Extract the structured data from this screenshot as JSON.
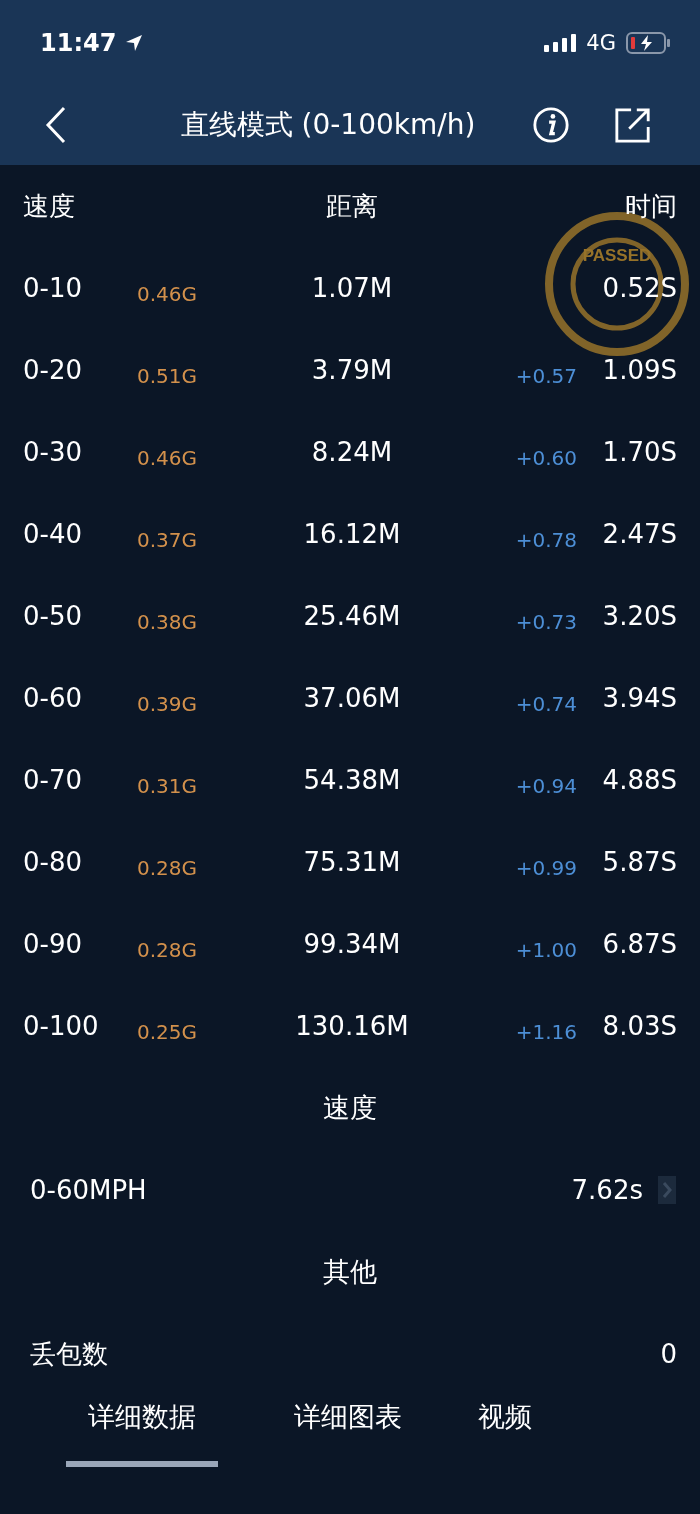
{
  "status_bar": {
    "time": "11:47",
    "network": "4G"
  },
  "nav": {
    "title": "直线模式 (0-100km/h)"
  },
  "table": {
    "columns": [
      "速度",
      "距离",
      "时间"
    ],
    "rows": [
      {
        "speed": "0-10",
        "g": "0.46G",
        "distance": "1.07M",
        "time": "0.52S"
      },
      {
        "speed": "0-20",
        "g": "0.51G",
        "distance": "3.79M",
        "delta": "+0.57",
        "time": "1.09S"
      },
      {
        "speed": "0-30",
        "g": "0.46G",
        "distance": "8.24M",
        "delta": "+0.60",
        "time": "1.70S"
      },
      {
        "speed": "0-40",
        "g": "0.37G",
        "distance": "16.12M",
        "delta": "+0.78",
        "time": "2.47S"
      },
      {
        "speed": "0-50",
        "g": "0.38G",
        "distance": "25.46M",
        "delta": "+0.73",
        "time": "3.20S"
      },
      {
        "speed": "0-60",
        "g": "0.39G",
        "distance": "37.06M",
        "delta": "+0.74",
        "time": "3.94S"
      },
      {
        "speed": "0-70",
        "g": "0.31G",
        "distance": "54.38M",
        "delta": "+0.94",
        "time": "4.88S"
      },
      {
        "speed": "0-80",
        "g": "0.28G",
        "distance": "75.31M",
        "delta": "+0.99",
        "time": "5.87S"
      },
      {
        "speed": "0-90",
        "g": "0.28G",
        "distance": "99.34M",
        "delta": "+1.00",
        "time": "6.87S"
      },
      {
        "speed": "0-100",
        "g": "0.25G",
        "distance": "130.16M",
        "delta": "+1.16",
        "time": "8.03S"
      }
    ]
  },
  "stamp": {
    "text": "PASSED"
  },
  "sections": [
    {
      "title": "速度",
      "rows": [
        {
          "label": "0-60MPH",
          "value": "7.62s",
          "has_link": true
        }
      ]
    },
    {
      "title": "其他",
      "rows": [
        {
          "label": "丢包数",
          "value": "0",
          "has_link": false
        }
      ]
    }
  ],
  "tabs": [
    {
      "label": "详细数据",
      "selected": true
    },
    {
      "label": "详细图表",
      "selected": false
    },
    {
      "label": "视频",
      "selected": false
    }
  ]
}
